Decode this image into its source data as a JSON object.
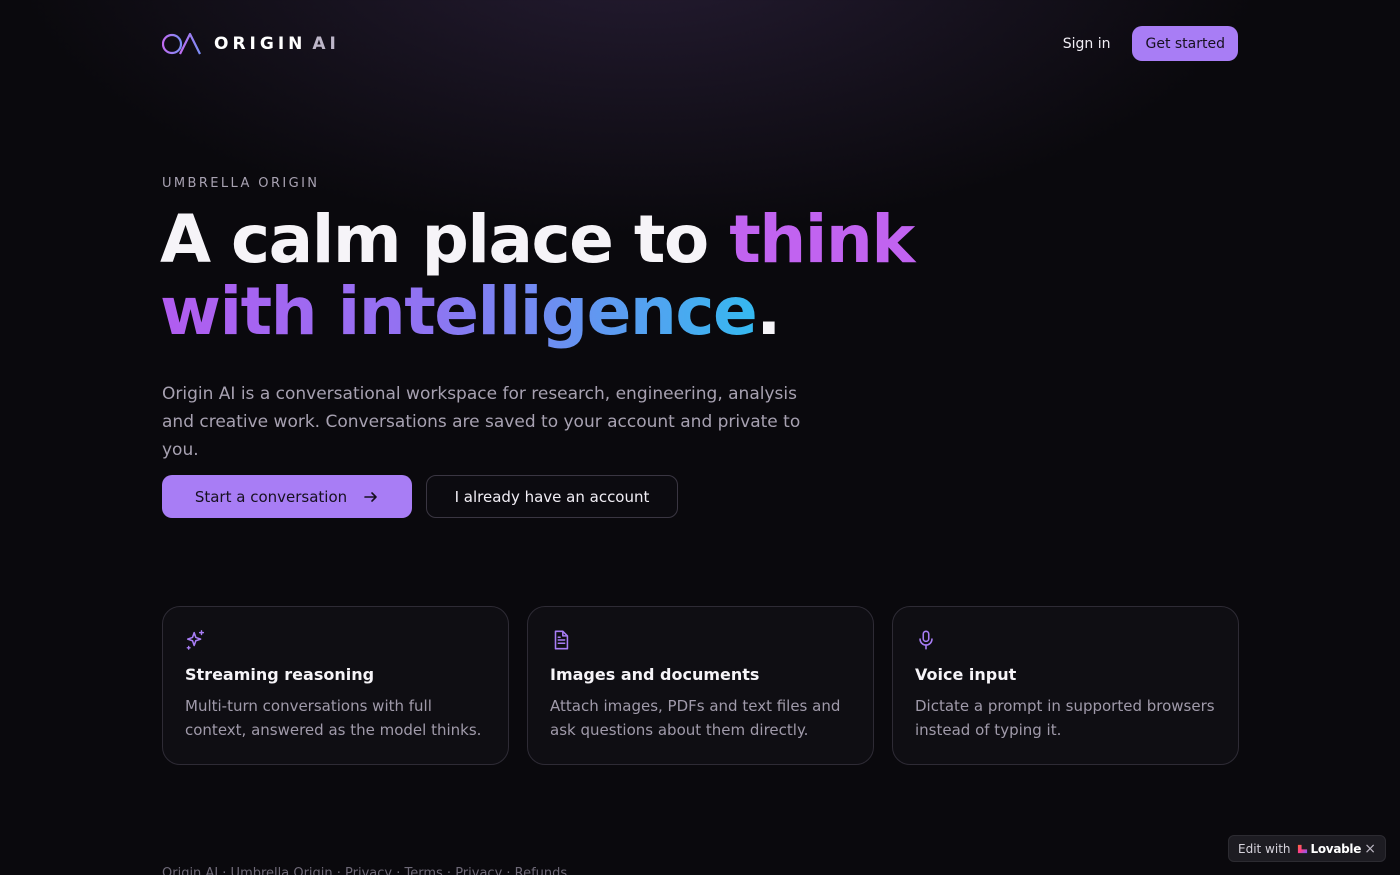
{
  "header": {
    "brand_name": "ORIGIN",
    "brand_suffix": "AI",
    "sign_in_label": "Sign in",
    "get_started_label": "Get started"
  },
  "hero": {
    "eyebrow": "UMBRELLA ORIGIN",
    "title_part1": "A calm place to ",
    "title_highlight1": "think",
    "title_highlight2": "with intelligence",
    "title_end": ".",
    "body": "Origin AI is a conversational workspace for research, engineering, analysis and creative work. Conversations are saved to your account and private to you.",
    "primary_cta": "Start a conversation",
    "secondary_cta": "I already have an account"
  },
  "features": [
    {
      "icon": "sparkles-icon",
      "title": "Streaming reasoning",
      "description": "Multi-turn conversations with full context, answered as the model thinks."
    },
    {
      "icon": "document-icon",
      "title": "Images and documents",
      "description": "Attach images, PDFs and text files and ask questions about them directly."
    },
    {
      "icon": "microphone-icon",
      "title": "Voice input",
      "description": "Dictate a prompt in supported browsers instead of typing it."
    }
  ],
  "footer": {
    "text": "Origin AI · Umbrella Origin · Privacy · Terms · Privacy · Refunds"
  },
  "badge": {
    "prefix": "Edit with",
    "brand": "Lovable",
    "close": "×"
  },
  "colors": {
    "accent": "#a87df5",
    "background": "#0a090d",
    "gradient_start": "#b25cf0",
    "gradient_end": "#35b9f0"
  }
}
